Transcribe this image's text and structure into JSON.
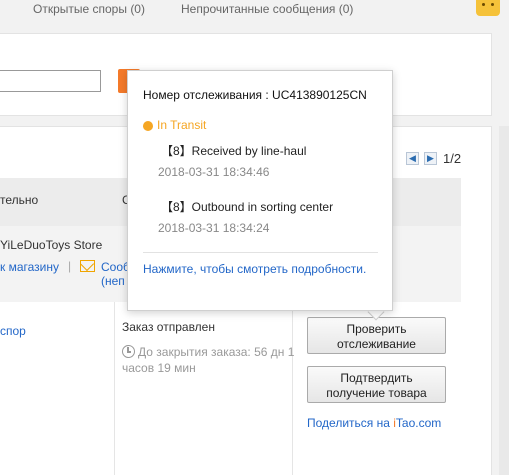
{
  "topnav": {
    "open_disputes": "Открытые споры (0)",
    "unread_messages": "Непрочитанные сообщения (0)",
    "mascot_icon": "fox-mascot-icon"
  },
  "pager": {
    "prev_icon": "chevron-left-icon",
    "next_icon": "chevron-right-icon",
    "page_text": "1/2"
  },
  "order_table": {
    "header_col1_fragment": "тельно",
    "header_col2_fragment": "С"
  },
  "store": {
    "name": "YiLeDuoToys Store",
    "link": "к магазину",
    "separator": "|",
    "message_link_line1": "Сооб",
    "message_link_line2": "(неп",
    "message_icon": "envelope-icon"
  },
  "order": {
    "dispute_link": "спор",
    "status": "Заказ отправлен",
    "countdown": "До закрытия заказа: 56 дн 1 часов 19 мин",
    "clock_icon": "clock-icon"
  },
  "actions": {
    "track_line1": "Проверить",
    "track_line2": "отслеживание",
    "confirm_line1": "Подтвердить",
    "confirm_line2": "получение товара",
    "share_prefix": "Поделиться на ",
    "share_brand_i": "i",
    "share_brand_rest": "Tao.com"
  },
  "tracking_popup": {
    "tracking_number": "Номер отслеживания : UC413890125CN",
    "status": "In Transit",
    "status_color": "#f5a623",
    "events": [
      {
        "title": "【8】Received by line-haul",
        "time": "2018-03-31 18:34:46"
      },
      {
        "title": "【8】Outbound in sorting center",
        "time": "2018-03-31 18:34:24"
      }
    ],
    "details_link": "Нажмите, чтобы смотреть подробности."
  },
  "colors": {
    "link": "#2367c8",
    "accent_orange": "#f47a2a"
  }
}
